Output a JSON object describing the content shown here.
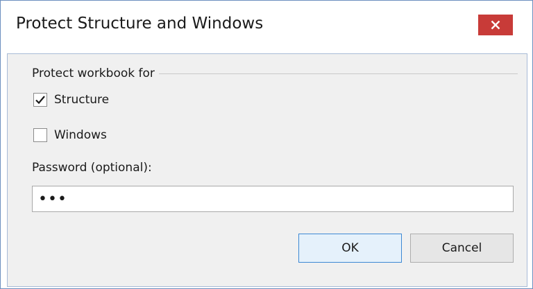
{
  "window": {
    "title": "Protect Structure and Windows",
    "close_icon": "close-icon"
  },
  "group": {
    "label": "Protect workbook for"
  },
  "options": {
    "structure": {
      "label": "Structure",
      "checked": true
    },
    "windows": {
      "label": "Windows",
      "checked": false
    }
  },
  "password": {
    "label": "Password (optional):",
    "value": "•••"
  },
  "buttons": {
    "ok": "OK",
    "cancel": "Cancel"
  },
  "colors": {
    "close_button": "#c83b38",
    "ok_border": "#3c88d4",
    "ok_background": "#e5f1fb",
    "client_background": "#f0f0f0"
  }
}
